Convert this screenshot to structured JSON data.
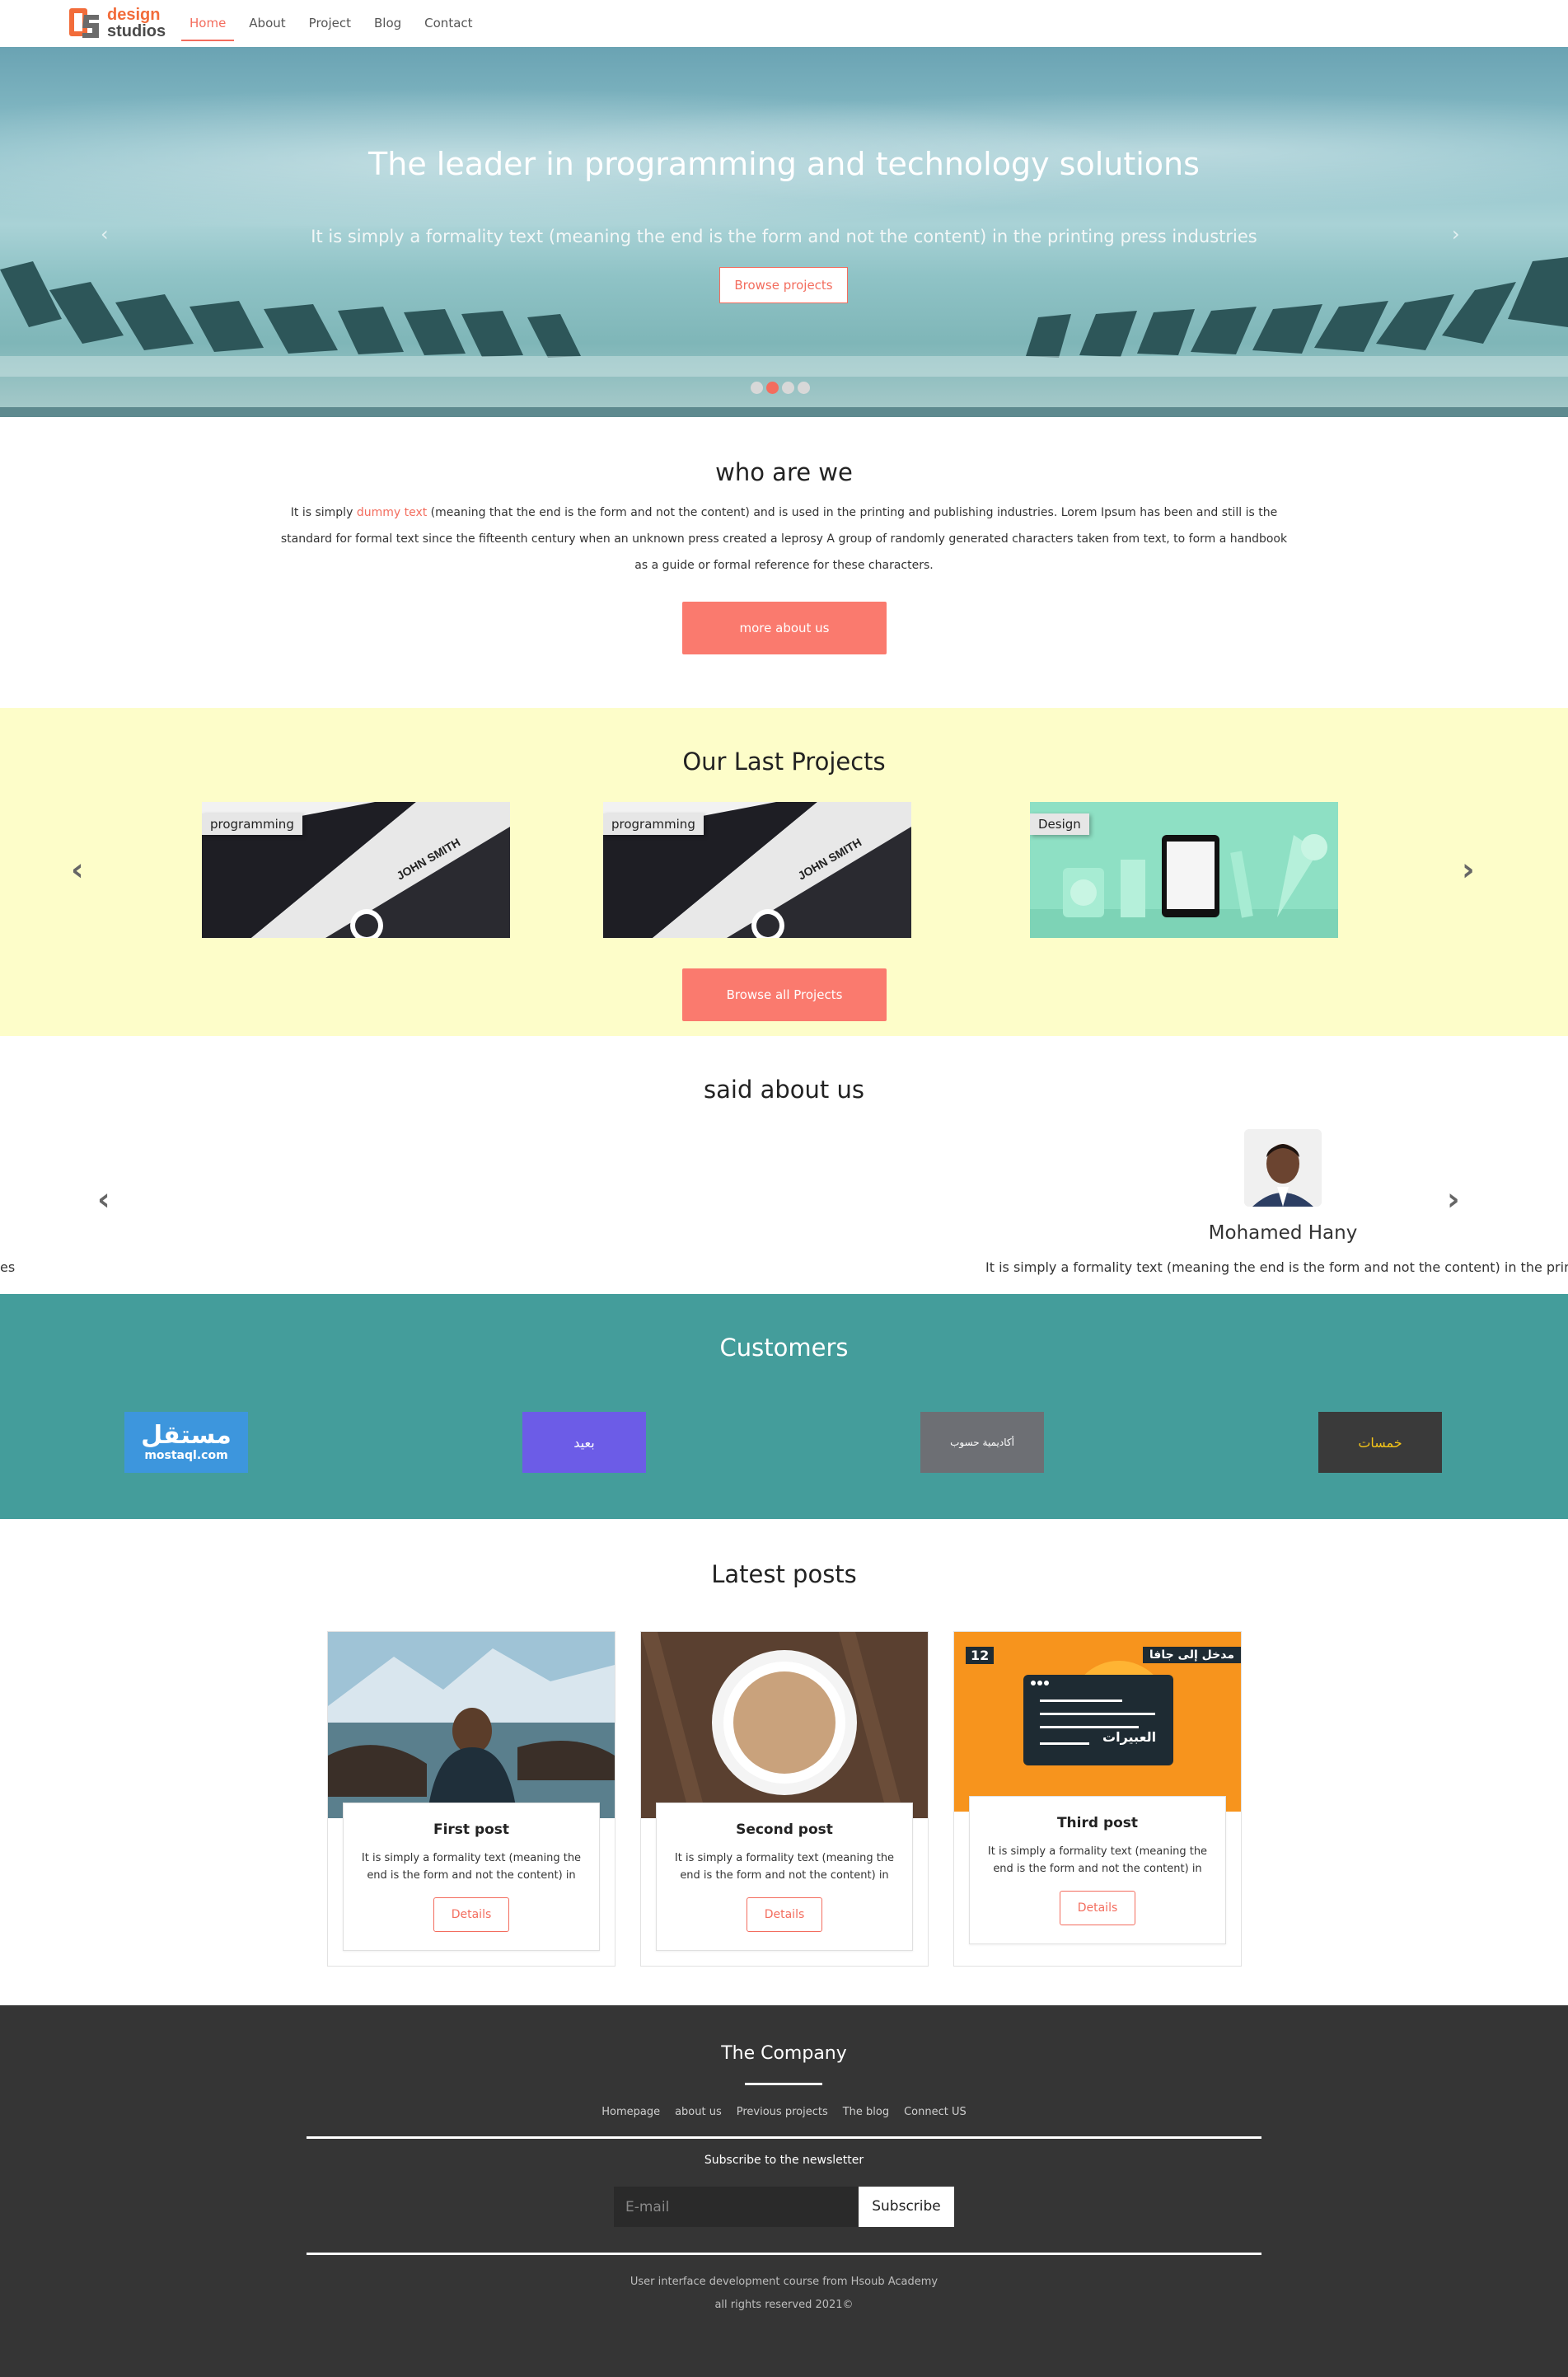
{
  "brand": {
    "mark": "DS",
    "line1": "design",
    "line2": "studios",
    "primary_color": "#f26c3a",
    "accent_color": "#f36d5e"
  },
  "nav": {
    "items": [
      {
        "label": "Home",
        "active": true
      },
      {
        "label": "About",
        "active": false
      },
      {
        "label": "Project",
        "active": false
      },
      {
        "label": "Blog",
        "active": false
      },
      {
        "label": "Contact",
        "active": false
      }
    ]
  },
  "hero": {
    "title": "The leader in programming and technology solutions",
    "subtitle": "It is simply a formality text (meaning the end is the form and not the content) in the printing press industries",
    "button": "Browse projects",
    "prev_icon": "‹",
    "next_icon": "›",
    "slides": 4,
    "active_slide": 2
  },
  "who": {
    "title": "who are we",
    "text_before": "It is simply ",
    "text_highlight": "dummy text",
    "text_after": " (meaning that the end is the form and not the content) and is used in the printing and publishing industries. Lorem Ipsum has been and still is the standard for formal text since the fifteenth century when an unknown press created a leprosy A group of randomly generated characters taken from text, to form a handbook as a guide or formal reference for these characters.",
    "button": "more about us"
  },
  "projects": {
    "title": "Our Last Projects",
    "items": [
      {
        "tag": "programming"
      },
      {
        "tag": "programming"
      },
      {
        "tag": "Design"
      }
    ],
    "button": "Browse all Projects",
    "bg_color": "#fdfdc9"
  },
  "testimonials": {
    "title": "said about us",
    "name": "Mohamed Hany",
    "text": "It is simply a formality text (meaning the end is the form and not the content) in the printing press industries",
    "edge_text": "es"
  },
  "customers": {
    "title": "Customers",
    "bg_color": "#449d9b",
    "logos": [
      {
        "name": "mostaql",
        "text_ar": "مستقل",
        "text_en": "mostaql.com"
      },
      {
        "name": "baeed",
        "text_ar": "بعيد",
        "text_en": ""
      },
      {
        "name": "academy",
        "text_ar": "أكاديمية حسوب",
        "text_en": ""
      },
      {
        "name": "khamsat",
        "text_ar": "خمسات",
        "text_en": ""
      }
    ]
  },
  "posts": {
    "title": "Latest posts",
    "items": [
      {
        "title": "First post",
        "text": "It is simply a formality text (meaning the end is the form and not the content) in the printing press industries",
        "button": "Details"
      },
      {
        "title": "Second post",
        "text": "It is simply a formality text (meaning the end is the form and not the content) in the printing press industries",
        "button": "Details"
      },
      {
        "title": "Third post",
        "text": "It is simply a formality text (meaning the end is the form and not the content) in the printing press industries",
        "button": "Details"
      }
    ],
    "third_image": {
      "number": "12",
      "banner": "مدخل إلى جافا",
      "caption": "العبيرات"
    }
  },
  "footer": {
    "title": "The Company",
    "links": [
      "Homepage",
      "about us",
      "Previous projects",
      "The blog",
      "Connect US"
    ],
    "subscribe_label": "Subscribe to the newsletter",
    "email_placeholder": "E-mail",
    "subscribe_button": "Subscribe",
    "credit": "User interface development course from Hsoub Academy",
    "rights": "all rights reserved 2021©"
  }
}
